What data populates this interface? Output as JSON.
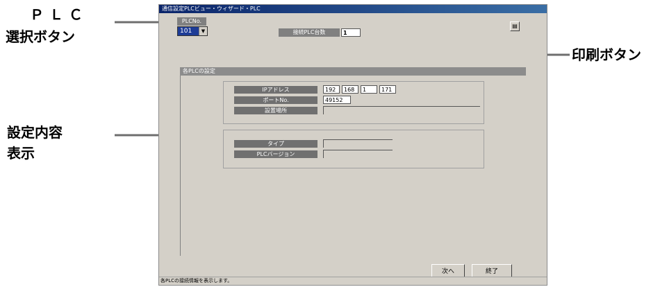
{
  "window": {
    "title": "通信設定PLCビュー・ウィザード・PLC",
    "status_text": "各PLCの接続情報を表示します。"
  },
  "plc_select": {
    "header": "PLCNo.",
    "value": "101"
  },
  "connection_count": {
    "label": "接続PLC台数",
    "value": "1"
  },
  "section": {
    "title": "各PLCの設定"
  },
  "group1": {
    "ip_label": "IPアドレス",
    "ip": [
      "192",
      "168",
      "1",
      "171"
    ],
    "port_label": "ポートNo.",
    "port": "49152",
    "location_label": "設置場所",
    "location": ""
  },
  "group2": {
    "type_label": "タイプ",
    "type": "",
    "version_label": "PLCバージョン",
    "version": ""
  },
  "buttons": {
    "next": "次へ",
    "finish": "終了"
  },
  "callouts": {
    "plc_line1": "ＰＬＣ",
    "plc_line2": "選択ボタン",
    "settings_line1": "設定内容",
    "settings_line2": "表示",
    "print": "印刷ボタン"
  }
}
